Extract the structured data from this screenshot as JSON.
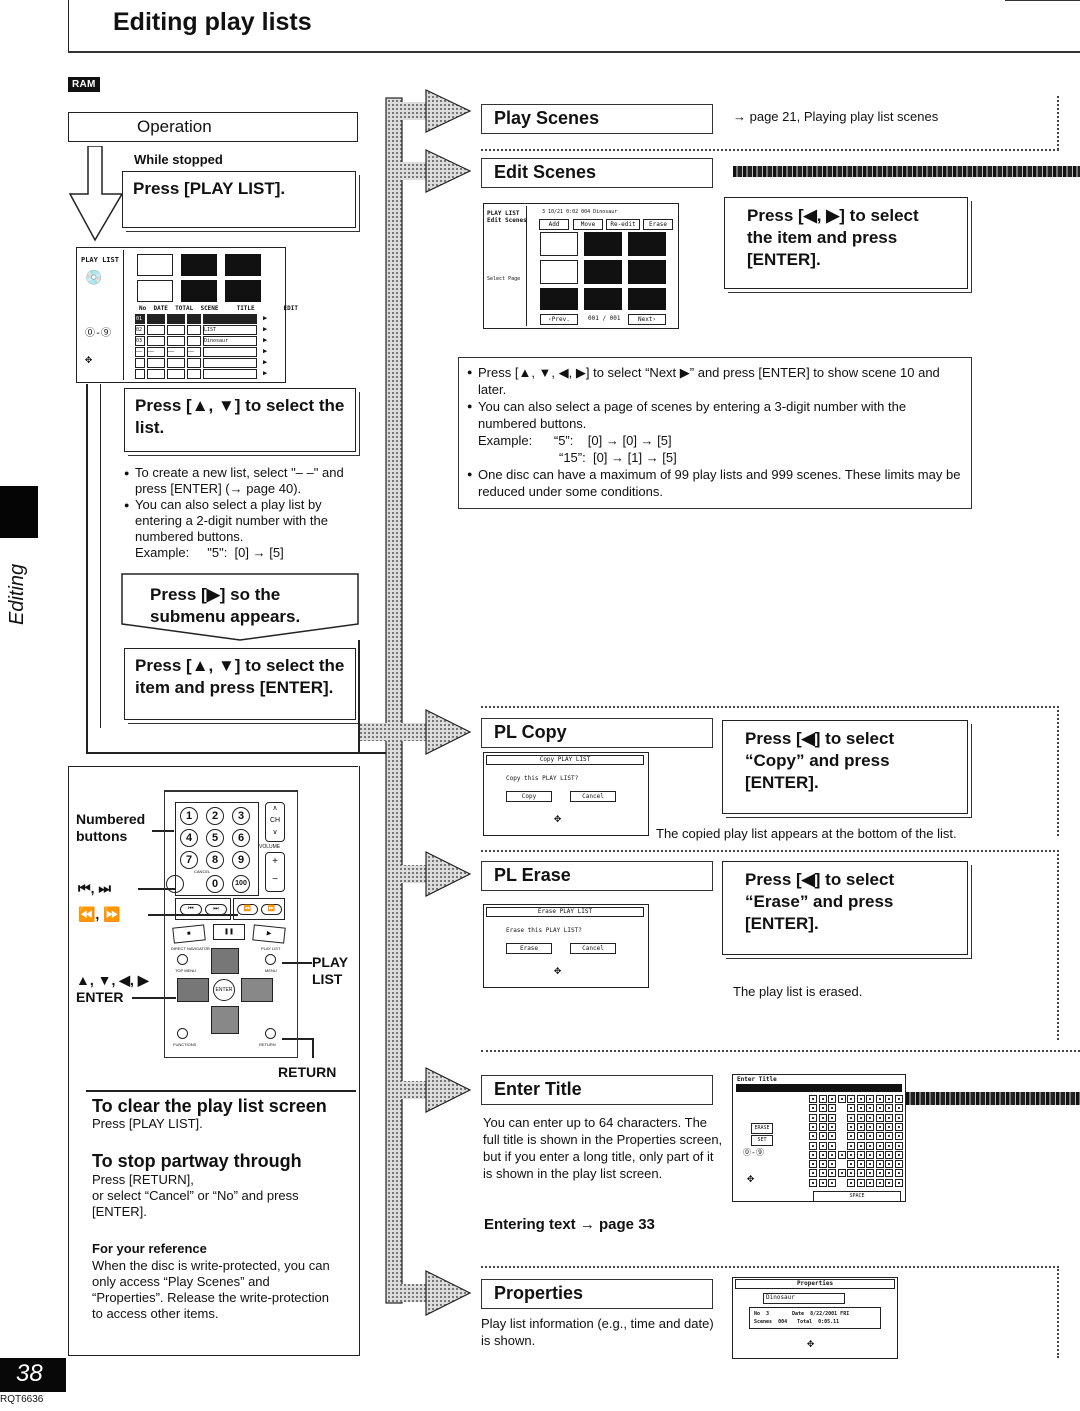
{
  "header": {
    "title": "Editing play lists",
    "disc_badge": "RAM"
  },
  "side_tab": {
    "label": "Editing"
  },
  "operation": {
    "heading": "Operation",
    "condition": "While stopped",
    "steps": [
      {
        "text": "Press [PLAY LIST]."
      },
      {
        "text": "Press [▲, ▼] to select the list."
      },
      {
        "text": "Press [▶] so the submenu appears."
      },
      {
        "text": "Press [▲, ▼] to select the item and press [ENTER]."
      }
    ],
    "list_notes": [
      "To create a new list, select \"– –\" and press [ENTER] (→ page 40).",
      "You can also select a play list by entering a 2-digit number with the numbered buttons."
    ],
    "list_example": "Example:     \"5\":  [0] → [5]"
  },
  "playlist_screen": {
    "label": "PLAY LIST",
    "columns": [
      "No",
      "DATE",
      "TOTAL",
      "SCENE",
      "TITLE",
      "EDIT"
    ],
    "rows": [
      [
        "01",
        "",
        "",
        "",
        "",
        "▶"
      ],
      [
        "02",
        "",
        "",
        "",
        "LIST",
        "▶"
      ],
      [
        "03",
        "",
        "",
        "",
        "Dinosaur",
        "▶"
      ],
      [
        "––",
        "––",
        "––",
        "––",
        "",
        "▶"
      ],
      [
        "",
        "",
        "",
        "",
        "",
        "▶"
      ],
      [
        "",
        "",
        "",
        "",
        "",
        "▶"
      ]
    ]
  },
  "remote": {
    "labels": {
      "numbered": "Numbered buttons",
      "skip": "⏮, ⏭",
      "search": "⏪, ⏩",
      "cursor": "▲, ▼, ◀, ▶",
      "enter": "ENTER",
      "play_list": "PLAY LIST",
      "return": "RETURN"
    },
    "keys": [
      "1",
      "2",
      "3",
      "4",
      "5",
      "6",
      "7",
      "8",
      "9",
      "0",
      "100"
    ],
    "small_labels": {
      "cancel": "CANCEL",
      "ch": "CH",
      "volume": "VOLUME",
      "direct_navigator": "DIRECT NAVIGATOR",
      "top_menu": "TOP MENU",
      "play_list_key": "PLAY LIST",
      "menu": "MENU",
      "enter_key": "ENTER",
      "functions": "FUNCTIONS",
      "return_key": "RETURN"
    }
  },
  "tips": {
    "clear_heading": "To clear the play list screen",
    "clear_body": "Press [PLAY LIST].",
    "stop_heading": "To stop partway through",
    "stop_body_1": "Press [RETURN],",
    "stop_body_2": "or select “Cancel” or “No” and press [ENTER].",
    "ref_heading": "For your reference",
    "ref_body": "When the disc is write-protected, you can only access “Play Scenes” and “Properties”. Release the write-protection to access other items."
  },
  "submenu": {
    "play_scenes": {
      "label": "Play Scenes",
      "ref": "→ page 21, Playing play list scenes"
    },
    "edit_scenes": {
      "label": "Edit Scenes",
      "step": "Press [◀, ▶] to select the item and press [ENTER].",
      "screen": {
        "title_line1": "PLAY LIST",
        "title_line2": "Edit Scenes",
        "info": "3  10/21  0:02  004  Dinosaur",
        "tabs": [
          "Add",
          "Move",
          "Re-edit",
          "Erase"
        ],
        "select_page": "Select Page",
        "prev": "‹Prev.",
        "page": "001 / 001",
        "next": "Next›"
      },
      "notes": [
        "Press [▲, ▼, ◀, ▶] to select “Next ▶” and press [ENTER] to show scene 10 and later.",
        "You can also select a page of scenes  by entering a 3-digit number with the numbered buttons.",
        "One disc can have a maximum of 99 play lists and 999 scenes. These limits may be reduced under some conditions."
      ],
      "example_1": "Example:      “5”:    [0] → [0] → [5]",
      "example_2": "“15”:  [0] → [1] → [5]"
    },
    "pl_copy": {
      "label": "PL Copy",
      "step": "Press [◀] to select “Copy” and press [ENTER].",
      "result": "The copied play list appears at the bottom of the list.",
      "dialog": {
        "title": "Copy PLAY LIST",
        "question": "Copy this PLAY LIST?",
        "ok": "Copy",
        "cancel": "Cancel"
      }
    },
    "pl_erase": {
      "label": "PL Erase",
      "step": "Press [◀] to select “Erase” and press [ENTER].",
      "result": "The play list is erased.",
      "dialog": {
        "title": "Erase PLAY LIST",
        "question": "Erase this PLAY LIST?",
        "ok": "Erase",
        "cancel": "Cancel"
      }
    },
    "enter_title": {
      "label": "Enter Title",
      "body": "You can enter up to 64 characters. The full title is shown in the Properties screen, but if you enter a long title, only part of it is shown in the play list screen.",
      "link": "Entering text → page 33",
      "screen": {
        "title": "Enter Title",
        "erase": "ERASE",
        "set": "SET",
        "space": "SPACE"
      }
    },
    "properties": {
      "label": "Properties",
      "body": "Play list information (e.g., time and date) is shown.",
      "screen": {
        "title": "Properties",
        "name": "Dinosaur",
        "no_label": "No",
        "no_value": "3",
        "date_label": "Date",
        "date_value": "8/22/2001  FRI",
        "scenes_label": "Scenes",
        "scenes_value": "004",
        "total_label": "Total",
        "total_value": "0:05.11"
      }
    }
  },
  "footer": {
    "page_number": "38",
    "doc_code": "RQT6636"
  }
}
